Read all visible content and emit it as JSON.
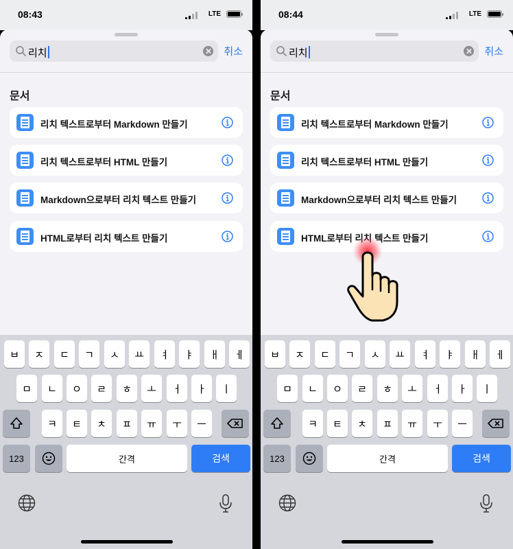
{
  "panels": [
    {
      "time": "08:43",
      "network": "LTE",
      "search": {
        "query": "리치",
        "cancel_label": "취소"
      },
      "section_title": "문서",
      "results": [
        {
          "label": "리치 텍스트로부터 Markdown 만들기"
        },
        {
          "label": "리치 텍스트로부터 HTML 만들기"
        },
        {
          "label": "Markdown으로부터 리치 텍스트 만들기"
        },
        {
          "label": "HTML로부터 리치 텍스트 만들기"
        }
      ]
    },
    {
      "time": "08:44",
      "network": "LTE",
      "search": {
        "query": "리치",
        "cancel_label": "취소"
      },
      "section_title": "문서",
      "results": [
        {
          "label": "리치 텍스트로부터 Markdown 만들기"
        },
        {
          "label": "리치 텍스트로부터 HTML 만들기"
        },
        {
          "label": "Markdown으로부터 리치 텍스트 만들기"
        },
        {
          "label": "HTML로부터 리치 텍스트 만들기"
        }
      ]
    }
  ],
  "keyboard": {
    "row1": [
      "ㅂ",
      "ㅈ",
      "ㄷ",
      "ㄱ",
      "ㅅ",
      "ㅛ",
      "ㅕ",
      "ㅑ",
      "ㅐ",
      "ㅔ"
    ],
    "row2": [
      "ㅁ",
      "ㄴ",
      "ㅇ",
      "ㄹ",
      "ㅎ",
      "ㅗ",
      "ㅓ",
      "ㅏ",
      "ㅣ"
    ],
    "row3": [
      "ㅋ",
      "ㅌ",
      "ㅊ",
      "ㅍ",
      "ㅠ",
      "ㅜ",
      "ㅡ"
    ],
    "numbers_label": "123",
    "space_label": "간격",
    "search_label": "검색"
  },
  "icons": {
    "document": "document-icon",
    "info": "info-icon",
    "clear": "clear-icon",
    "shift": "shift-icon",
    "backspace": "backspace-icon",
    "emoji": "emoji-icon",
    "globe": "globe-icon",
    "mic": "microphone-icon",
    "tap_hand": "hand-pointer-icon"
  },
  "colors": {
    "accent": "#2f7cf6",
    "doc_icon": "#3d8ef7",
    "tap_glow": "#ff3b4e"
  }
}
